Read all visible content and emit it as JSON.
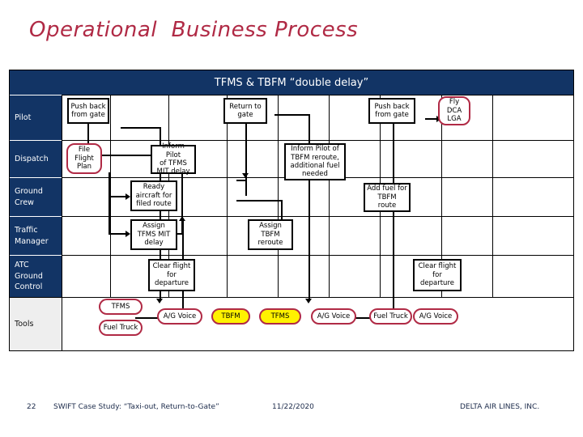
{
  "slide": {
    "title": "Operational  Business Process",
    "banner": "TFMS & TBFM “double delay”",
    "accent_color": "#B02A45",
    "banner_color": "#123465",
    "highlight_color": "#FFF200"
  },
  "swimlanes": [
    {
      "id": "pilot",
      "label": "Pilot"
    },
    {
      "id": "dispatch",
      "label": "Dispatch"
    },
    {
      "id": "ground",
      "label": "Ground\nCrew"
    },
    {
      "id": "traffic",
      "label": "Traffic\nManager"
    },
    {
      "id": "atc",
      "label": "ATC\nGround\nControl"
    },
    {
      "id": "tools",
      "label": "Tools"
    }
  ],
  "boxes": {
    "file_flight_plan": "File\nFlight\nPlan",
    "push_back_1": "Push back\nfrom gate",
    "inform_pilot_tfms": "Inform Pilot\nof TFMS\nMIT delay",
    "ready_aircraft": "Ready\naircraft for\nfiled route",
    "assign_tfms_mit": "Assign\nTFMS MIT\ndelay",
    "clear_flight_1": "Clear flight\nfor\ndeparture",
    "inform_pilot_tbfm": "Inform Pilot of\nTBFM reroute,\nadditional fuel\nneeded",
    "return_to_gate": "Return to\ngate",
    "add_fuel": "Add fuel for\nTBFM\nroute",
    "assign_tbfm_reroute": "Assign\nTBFM\nreroute",
    "clear_flight_2": "Clear flight\nfor\ndeparture",
    "push_back_2": "Push back\nfrom gate",
    "fly_dca_lga": "Fly\nDCA\nLGA"
  },
  "tools": [
    {
      "label": "TFMS",
      "highlight": false
    },
    {
      "label": "Fuel Truck",
      "highlight": false
    },
    {
      "label": "A/G Voice",
      "highlight": false
    },
    {
      "label": "TBFM",
      "highlight": true
    },
    {
      "label": "TFMS",
      "highlight": true
    },
    {
      "label": "A/G Voice",
      "highlight": false
    },
    {
      "label": "Fuel Truck",
      "highlight": false
    },
    {
      "label": "A/G Voice",
      "highlight": false
    }
  ],
  "footer": {
    "page": "22",
    "title": "SWIFT Case Study: “Taxi-out, Return-to-Gate”",
    "date": "11/22/2020",
    "company": "DELTA AIR LINES, INC."
  }
}
